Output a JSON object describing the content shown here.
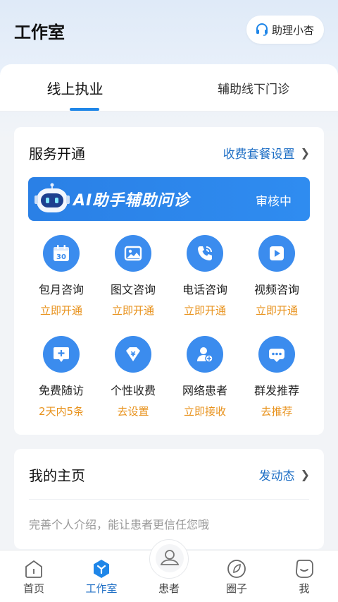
{
  "header": {
    "title": "工作室",
    "assistant_label": "助理小杏"
  },
  "tabs": [
    {
      "label": "线上执业",
      "active": true
    },
    {
      "label": "辅助线下门诊",
      "active": false
    }
  ],
  "services_card": {
    "title": "服务开通",
    "link_label": "收费套餐设置",
    "ai_banner": {
      "title": "AI助手辅助问诊",
      "status": "审核中"
    },
    "items": [
      {
        "label": "包月咨询",
        "action": "立即开通",
        "icon": "calendar-icon",
        "calendar_day": "30"
      },
      {
        "label": "图文咨询",
        "action": "立即开通",
        "icon": "image-icon"
      },
      {
        "label": "电话咨询",
        "action": "立即开通",
        "icon": "phone-icon"
      },
      {
        "label": "视频咨询",
        "action": "立即开通",
        "icon": "video-icon"
      },
      {
        "label": "免费随访",
        "action": "2天内5条",
        "icon": "chat-plus-icon"
      },
      {
        "label": "个性收费",
        "action": "去设置",
        "icon": "yen-diamond-icon",
        "symbol": "¥"
      },
      {
        "label": "网络患者",
        "action": "立即接收",
        "icon": "doctor-add-icon"
      },
      {
        "label": "群发推荐",
        "action": "去推荐",
        "icon": "group-message-icon"
      }
    ]
  },
  "home_card": {
    "title": "我的主页",
    "link_label": "发动态",
    "hint": "完善个人介绍，能让患者更信任您哦"
  },
  "bottom_nav": [
    {
      "label": "首页",
      "icon": "home-icon",
      "active": false
    },
    {
      "label": "工作室",
      "icon": "workspace-icon",
      "active": true
    },
    {
      "label": "患者",
      "icon": "patient-icon",
      "active": false
    },
    {
      "label": "圈子",
      "icon": "circle-icon",
      "active": false
    },
    {
      "label": "我",
      "icon": "profile-icon",
      "active": false
    }
  ],
  "colors": {
    "primary": "#1f86e8",
    "link": "#1f6fc5",
    "action": "#e8921c",
    "icon_bg": "#3b8cee"
  }
}
